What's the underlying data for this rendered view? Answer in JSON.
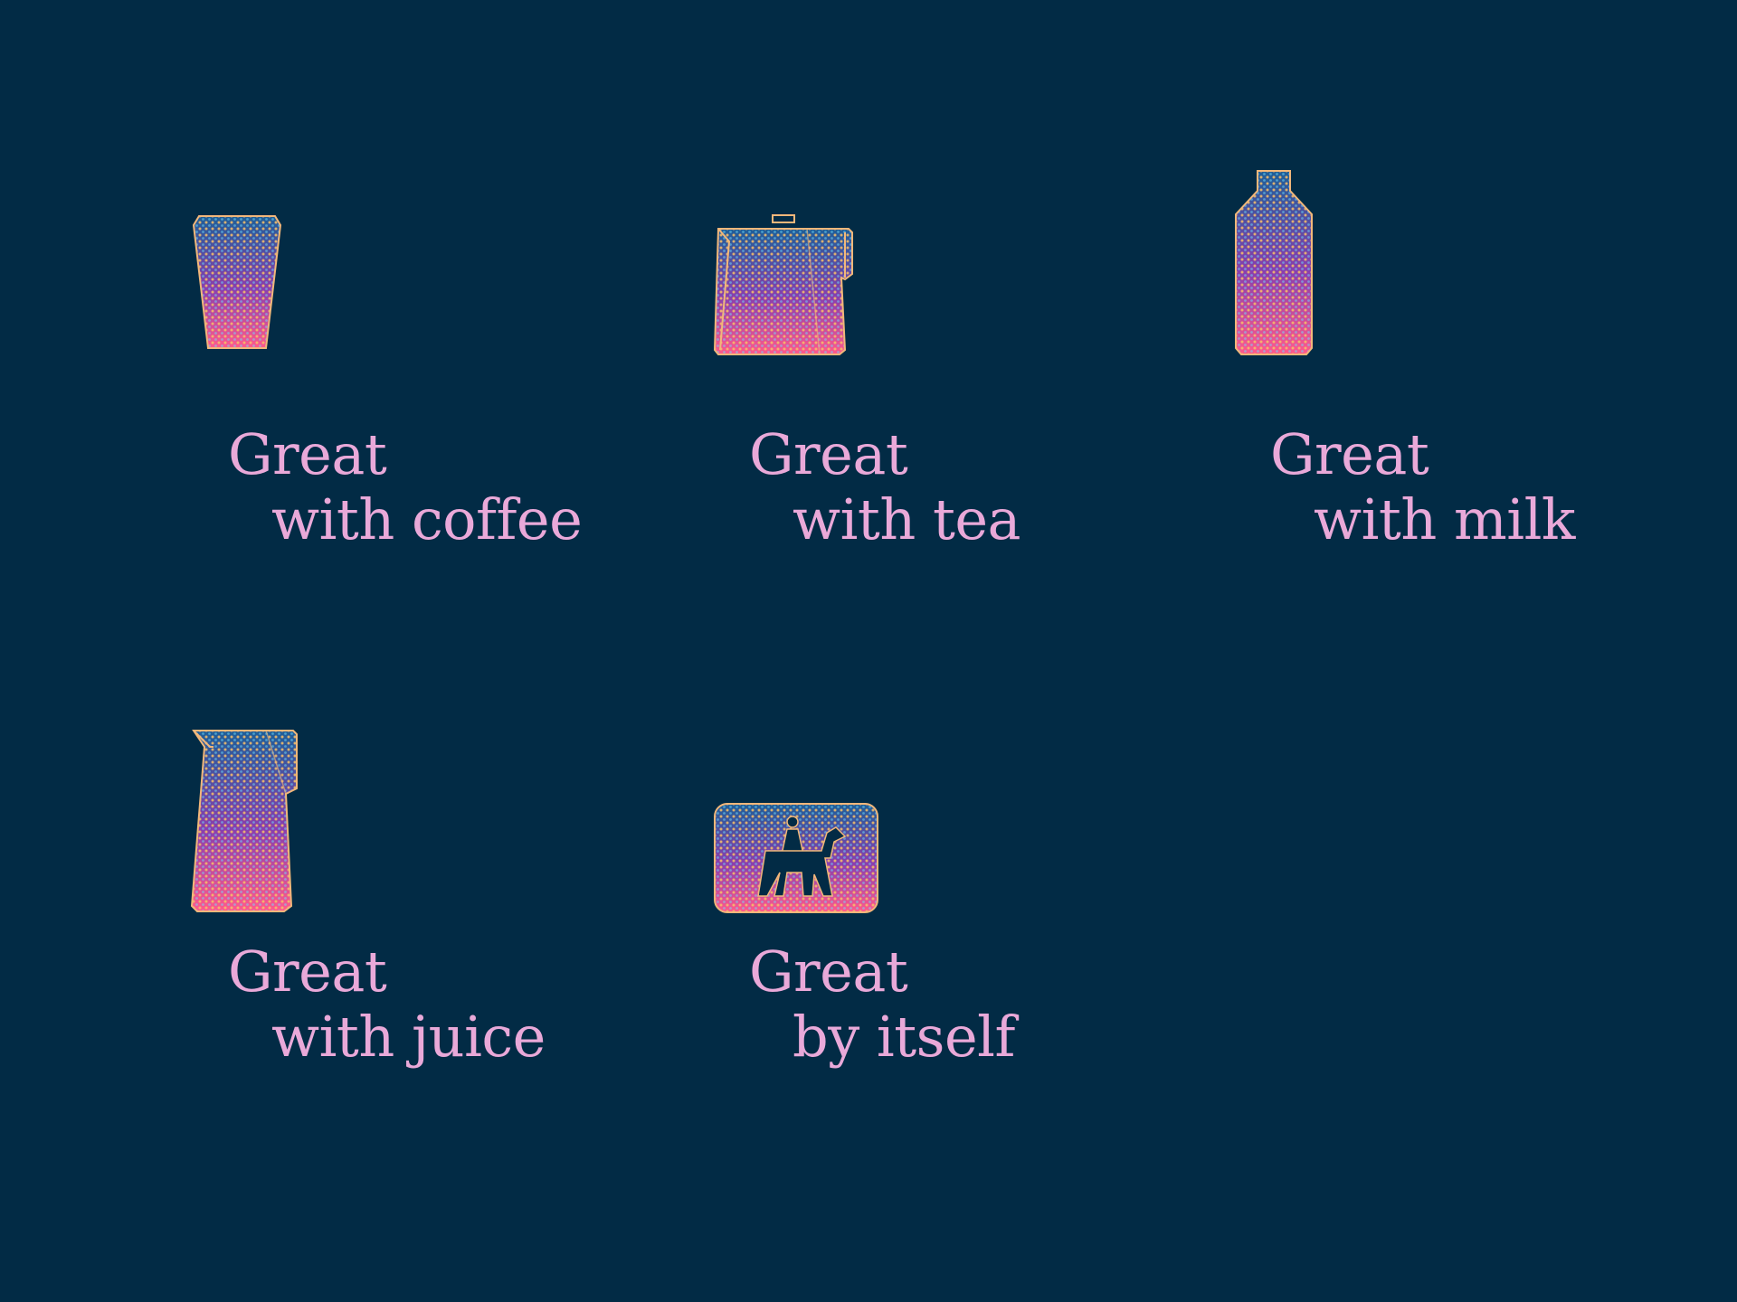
{
  "colors": {
    "background": "#022b45",
    "text": "#e9a9d9",
    "outline": "#f2b77a",
    "dot_top": "#2a6fa8",
    "dot_mid": "#9a3fb0",
    "dot_bottom": "#ff4f8f"
  },
  "items": [
    {
      "icon": "cup-icon",
      "line1": "Great",
      "line2": "with coffee"
    },
    {
      "icon": "teapot-icon",
      "line1": "Great",
      "line2": "with tea"
    },
    {
      "icon": "bottle-icon",
      "line1": "Great",
      "line2": "with milk"
    },
    {
      "icon": "pitcher-icon",
      "line1": "Great",
      "line2": "with juice"
    },
    {
      "icon": "horse-rider-badge-icon",
      "line1": "Great",
      "line2": "by itself"
    }
  ]
}
